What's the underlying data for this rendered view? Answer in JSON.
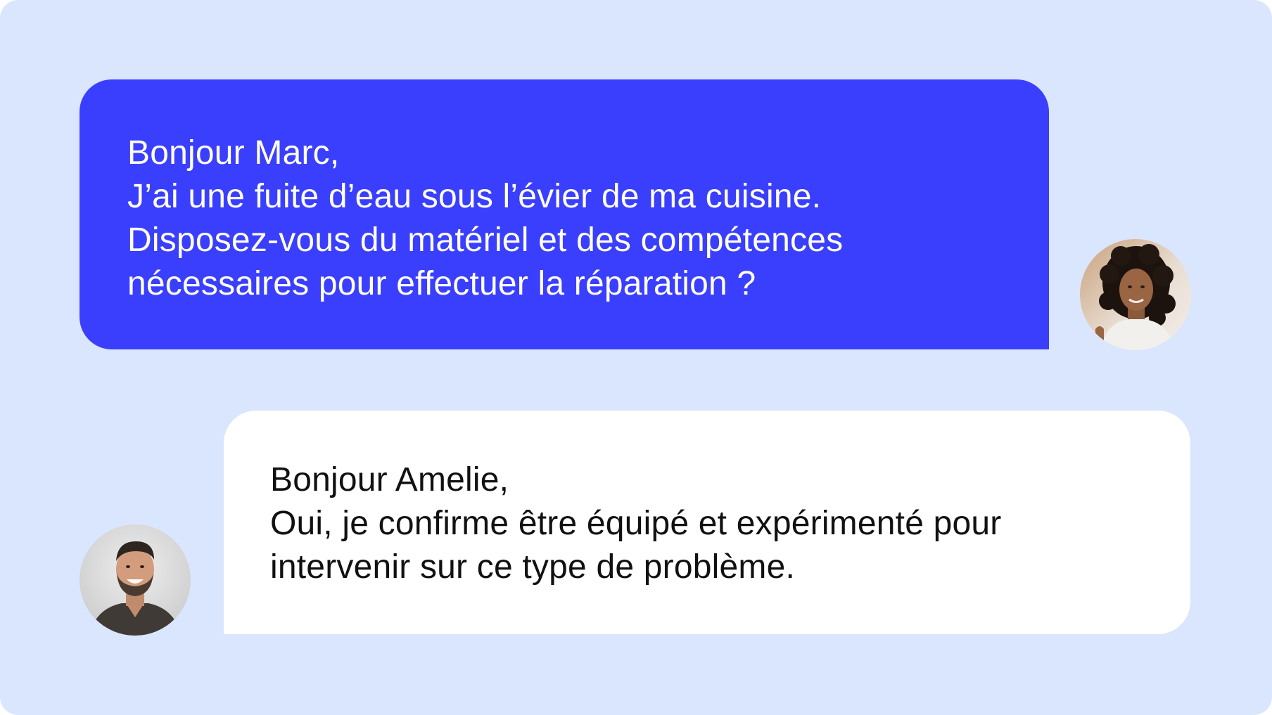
{
  "conversation": {
    "messages": [
      {
        "sender": "Amelie",
        "direction": "outgoing",
        "lines": [
          "Bonjour Marc,",
          "J’ai une fuite d’eau sous l’évier de ma cuisine.",
          "Disposez-vous du matériel et des compétences",
          "nécessaires pour effectuer la réparation ?"
        ]
      },
      {
        "sender": "Marc",
        "direction": "incoming",
        "lines": [
          "Bonjour Amelie,",
          "Oui, je confirme être équipé et expérimenté pour",
          "intervenir sur ce type de problème."
        ]
      }
    ]
  },
  "colors": {
    "background": "#dae6fd",
    "outgoing_bubble": "#3a3ffd",
    "outgoing_text": "#ffffff",
    "incoming_bubble": "#ffffff",
    "incoming_text": "#111111"
  },
  "avatars": {
    "amelie": {
      "icon": "woman-avatar-photo"
    },
    "marc": {
      "icon": "man-avatar-photo"
    }
  }
}
